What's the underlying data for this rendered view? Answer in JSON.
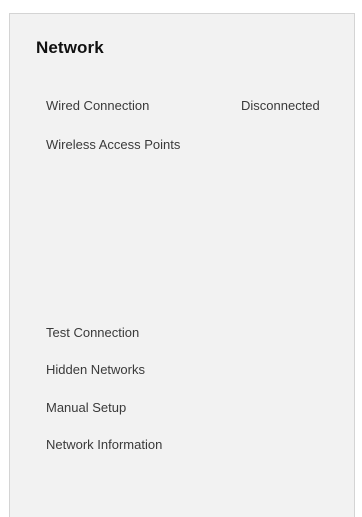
{
  "panel": {
    "title": "Network"
  },
  "wired": {
    "label": "Wired Connection",
    "status": "Disconnected"
  },
  "wireless": {
    "label": "Wireless Access Points"
  },
  "actions": {
    "test_connection": "Test Connection",
    "hidden_networks": "Hidden Networks",
    "manual_setup": "Manual Setup",
    "network_information": "Network Information"
  }
}
